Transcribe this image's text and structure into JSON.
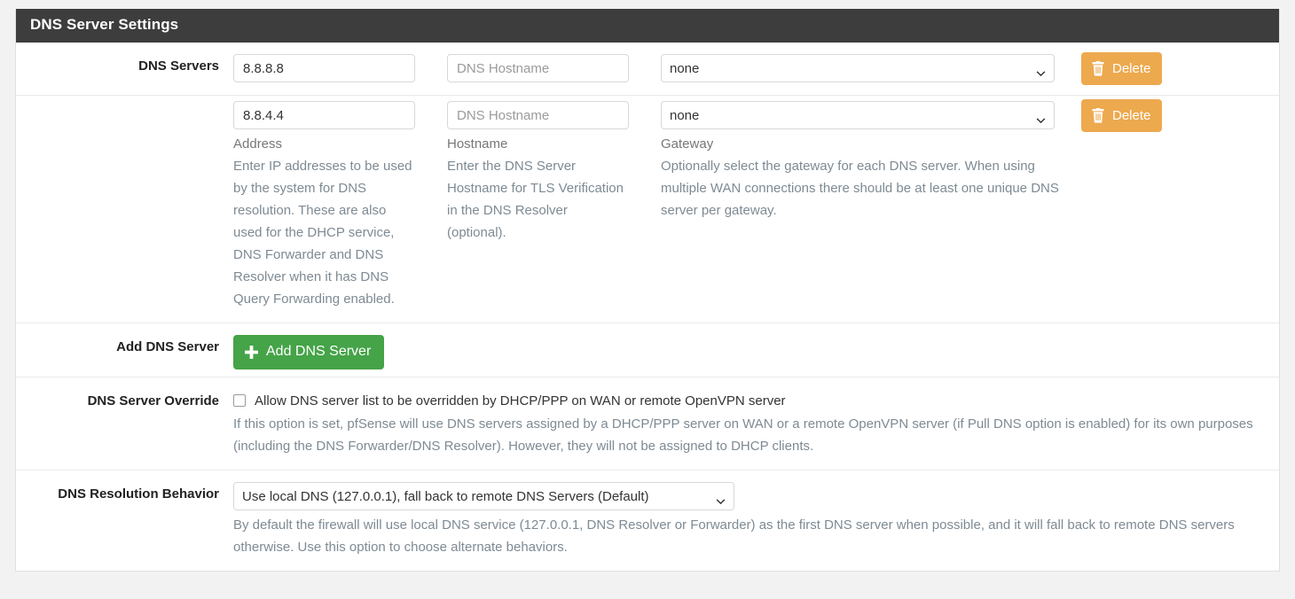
{
  "panel": {
    "title": "DNS Server Settings"
  },
  "dns_servers": {
    "label": "DNS Servers",
    "rows": [
      {
        "address": "8.8.8.8",
        "address_placeholder": "",
        "hostname": "",
        "hostname_placeholder": "DNS Hostname",
        "gateway": "none",
        "delete_label": "Delete",
        "delete_icon": "trash-icon"
      },
      {
        "address": "8.8.4.4",
        "address_placeholder": "",
        "hostname": "",
        "hostname_placeholder": "DNS Hostname",
        "gateway": "none",
        "delete_label": "Delete",
        "delete_icon": "trash-icon"
      }
    ],
    "gateway_options": [
      "none"
    ],
    "help": {
      "address_title": "Address",
      "address_text": "Enter IP addresses to be used by the system for DNS resolution. These are also used for the DHCP service, DNS Forwarder and DNS Resolver when it has DNS Query Forwarding enabled.",
      "hostname_title": "Hostname",
      "hostname_text": "Enter the DNS Server Hostname for TLS Verification in the DNS Resolver (optional).",
      "gateway_title": "Gateway",
      "gateway_text": "Optionally select the gateway for each DNS server. When using multiple WAN connections there should be at least one unique DNS server per gateway."
    }
  },
  "add_dns_server": {
    "label": "Add DNS Server",
    "button_label": "Add DNS Server",
    "button_icon": "plus-icon"
  },
  "dns_server_override": {
    "label": "DNS Server Override",
    "checkbox_checked": false,
    "checkbox_label": "Allow DNS server list to be overridden by DHCP/PPP on WAN or remote OpenVPN server",
    "help_text": "If this option is set, pfSense will use DNS servers assigned by a DHCP/PPP server on WAN or a remote OpenVPN server (if Pull DNS option is enabled) for its own purposes (including the DNS Forwarder/DNS Resolver). However, they will not be assigned to DHCP clients."
  },
  "dns_resolution_behavior": {
    "label": "DNS Resolution Behavior",
    "selected": "Use local DNS (127.0.0.1), fall back to remote DNS Servers (Default)",
    "options": [
      "Use local DNS (127.0.0.1), fall back to remote DNS Servers (Default)"
    ],
    "help_text": "By default the firewall will use local DNS service (127.0.0.1, DNS Resolver or Forwarder) as the first DNS server when possible, and it will fall back to remote DNS servers otherwise. Use this option to choose alternate behaviors."
  },
  "colors": {
    "header_bg": "#3d3d3d",
    "delete_button": "#eda94e",
    "add_button": "#45a348",
    "help_text": "#7e8a93"
  }
}
